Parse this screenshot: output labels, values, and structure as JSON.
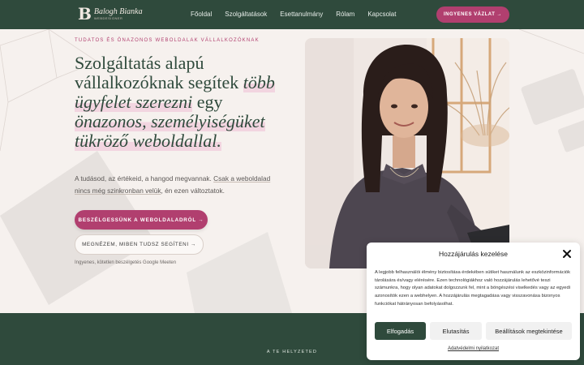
{
  "header": {
    "logo_mark": "B",
    "logo_name": "Balogh Bianka",
    "logo_sub": "WEBDESIGNER",
    "nav": [
      "Főoldal",
      "Szolgáltatások",
      "Esettanulmány",
      "Rólam",
      "Kapcsolat"
    ],
    "cta": "INGYENES VÁZLAT →"
  },
  "hero": {
    "eyebrow": "TUDATOS ÉS ÖNAZONOS WEBOLDALAK VÁLLALKOZÓKNAK",
    "headline_part1": "Szolgáltatás alapú vállalkozóknak segítek ",
    "headline_em1": "több ügyfelet szerezni",
    "headline_part2": " egy ",
    "headline_em2": "önazonos, személyiségüket tükröző weboldallal.",
    "lead_part1": "A tudásod, az értékeid, a hangod megvannak. ",
    "lead_underlined": "Csak a weboldalad nincs még szinkronban velük",
    "lead_part2": ", én ezen változtatok.",
    "primary_button": "BESZÉLGESSÜNK A WEBOLDALADRÓL  →",
    "secondary_button": "MEGNÉZEM, MIBEN TUDSZ SEGÍTENI  →",
    "note": "Ingyenes, kötetlen beszélgetés Google Meeten"
  },
  "bottom": {
    "label": "A TE HELYZETED"
  },
  "cookie": {
    "title": "Hozzájárulás kezelése",
    "text": "A legjobb felhasználói élmény biztosítása érdekében sütiket használunk az eszközinformációk tárolására és/vagy elérésére. Ezen technológiákhoz való hozzájárulás lehetővé teszi számunkra, hogy olyan adatokat dolgozzunk fel, mint a böngészési viselkedés vagy az egyedi azonosítók ezen a webhelyen. A hozzájárulás megtagadása vagy visszavonása bizonyos funkciókat hátrányosan befolyásolhat.",
    "accept": "Elfogadás",
    "deny": "Elutasítás",
    "preferences": "Beállítások megtekintése",
    "privacy_link": "Adatvédelmi nyilatkozat"
  },
  "colors": {
    "brand_green": "#2f4a3c",
    "brand_pink": "#b13f6f",
    "highlight": "#f2d5e0",
    "background": "#f6f1ee"
  }
}
